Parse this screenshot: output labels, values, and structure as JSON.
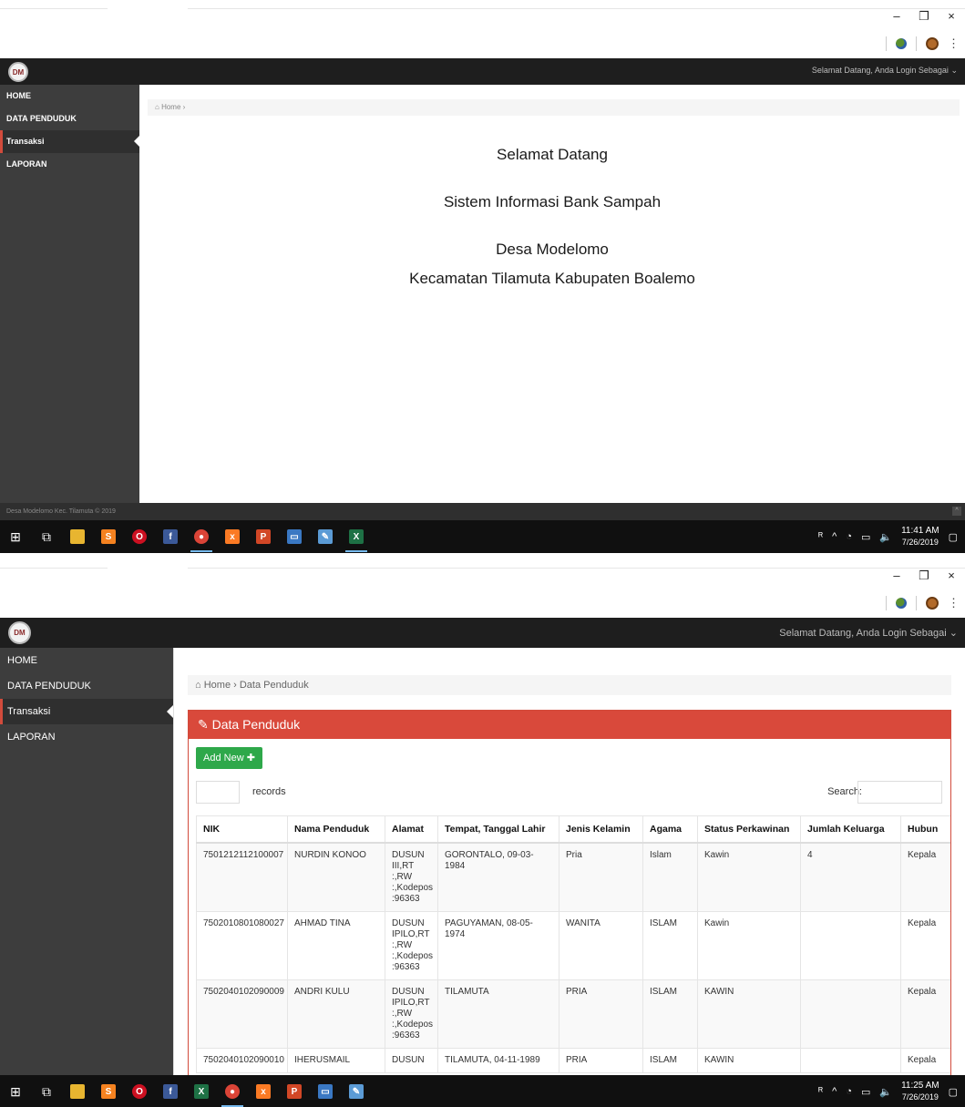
{
  "s1": {
    "user_menu": "Selamat Datang, Anda Login Sebagai",
    "nav": [
      {
        "label": "HOME"
      },
      {
        "label": "DATA PENDUDUK"
      },
      {
        "label": "Transaksi"
      },
      {
        "label": "LAPORAN"
      }
    ],
    "breadcrumb": "Home",
    "welcome": {
      "line1": "Selamat Datang",
      "line2": "Sistem Informasi Bank Sampah",
      "line3": "Desa Modelomo",
      "line4": "Kecamatan Tilamuta Kabupaten Boalemo"
    },
    "footer": "Desa Modelomo Kec. Tilamuta © 2019",
    "clock_time": "11:41 AM",
    "clock_date": "7/26/2019"
  },
  "s2": {
    "user_menu": "Selamat Datang, Anda Login Sebagai",
    "nav": [
      {
        "label": "HOME"
      },
      {
        "label": "DATA PENDUDUK"
      },
      {
        "label": "Transaksi"
      },
      {
        "label": "LAPORAN"
      }
    ],
    "breadcrumb_home": "Home",
    "breadcrumb_current": "Data Penduduk",
    "panel_title": "Data Penduduk",
    "add_button": "Add New",
    "records_label": "records",
    "search_label": "Search:",
    "columns": [
      "NIK",
      "Nama Penduduk",
      "Alamat",
      "Tempat, Tanggal Lahir",
      "Jenis Kelamin",
      "Agama",
      "Status Perkawinan",
      "Jumlah Keluarga",
      "Hubun"
    ],
    "rows": [
      [
        "7501212112100007",
        "NURDIN KONOO",
        "DUSUN III,RT :,RW :,Kodepos :96363",
        "GORONTALO, 09-03-1984",
        "Pria",
        "Islam",
        "Kawin",
        "4",
        "Kepala"
      ],
      [
        "7502010801080027",
        "AHMAD TINA",
        "DUSUN IPILO,RT :,RW :,Kodepos :96363",
        "PAGUYAMAN, 08-05-1974",
        "WANITA",
        "ISLAM",
        "Kawin",
        "",
        "Kepala"
      ],
      [
        "7502040102090009",
        "ANDRI KULU",
        "DUSUN IPILO,RT :,RW :,Kodepos :96363",
        "TILAMUTA",
        "PRIA",
        "ISLAM",
        "KAWIN",
        "",
        "Kepala"
      ],
      [
        "7502040102090010",
        "IHERUSMAIL",
        "DUSUN",
        "TILAMUTA, 04-11-1989",
        "PRIA",
        "ISLAM",
        "KAWIN",
        "",
        "Kepala"
      ]
    ],
    "clock_time": "11:25 AM",
    "clock_date": "7/26/2019"
  },
  "window_controls": {
    "minimize": "–",
    "restore": "❐",
    "close": "×"
  },
  "colors": {
    "accent_red": "#d9493b",
    "add_green": "#2ea84a",
    "sidebar": "#3d3d3d",
    "topbar": "#1e1e1e"
  }
}
